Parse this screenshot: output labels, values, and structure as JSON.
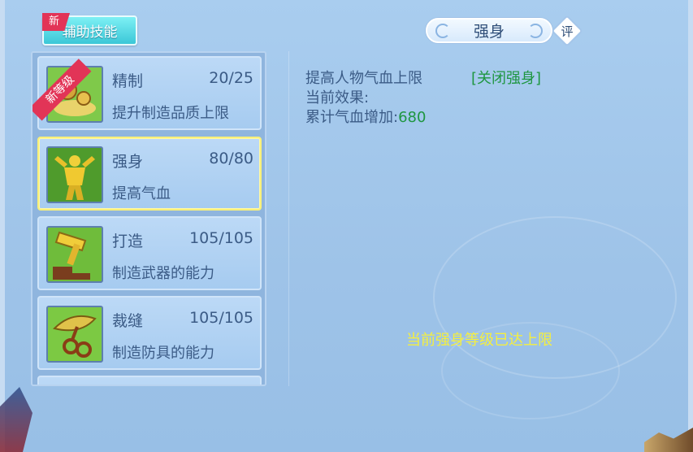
{
  "tab": {
    "label": "辅助技能",
    "badge": "新"
  },
  "skills": [
    {
      "name": "精制",
      "level": "20/25",
      "desc": "提升制造品质上限",
      "ribbon": "新等级",
      "icon": "herbs-pouch-icon"
    },
    {
      "name": "强身",
      "level": "80/80",
      "desc": "提高气血",
      "icon": "muscle-man-icon"
    },
    {
      "name": "打造",
      "level": "105/105",
      "desc": "制造武器的能力",
      "icon": "hammer-anvil-icon"
    },
    {
      "name": "裁缝",
      "level": "105/105",
      "desc": "制造防具的能力",
      "icon": "scissors-icon"
    }
  ],
  "detail": {
    "title": "强身",
    "rate_label": "评",
    "effect_line": "提高人物气血上限",
    "toggle_link": "[关闭强身]",
    "current_effect_label": "当前效果:",
    "cumulative_label": "累计气血增加:",
    "cumulative_value": "680",
    "max_notice": "当前强身等级已达上限"
  },
  "colors": {
    "selected_border": "#f8f07a",
    "green_text": "#1e9640",
    "notice_yellow": "#f5ef3f",
    "badge_red": "#e23457"
  }
}
